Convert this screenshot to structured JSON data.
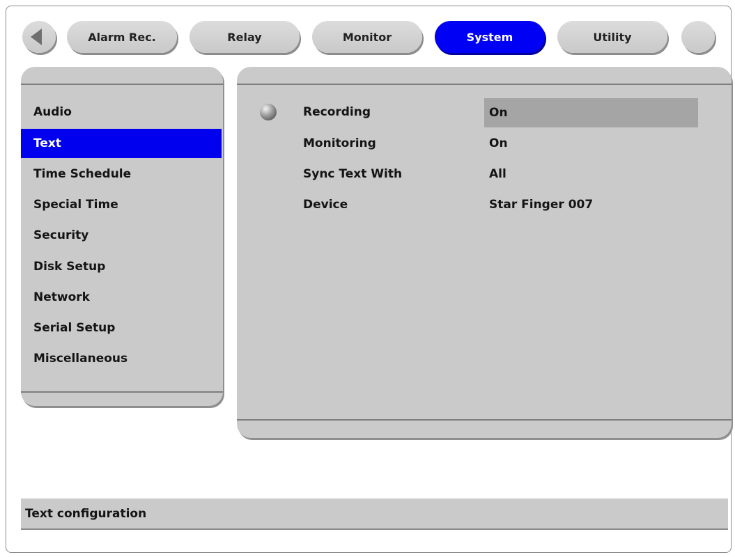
{
  "tabs": [
    {
      "label": "Alarm Rec."
    },
    {
      "label": "Relay"
    },
    {
      "label": "Monitor"
    },
    {
      "label": "System",
      "active": true
    },
    {
      "label": "Utility"
    }
  ],
  "sidebar": {
    "items": [
      {
        "label": "Audio"
      },
      {
        "label": "Text",
        "selected": true
      },
      {
        "label": "Time Schedule"
      },
      {
        "label": "Special Time"
      },
      {
        "label": "Security"
      },
      {
        "label": "Disk Setup"
      },
      {
        "label": "Network"
      },
      {
        "label": "Serial Setup"
      },
      {
        "label": "Miscellaneous"
      }
    ]
  },
  "settings": {
    "rows": [
      {
        "label": "Recording",
        "value": "On"
      },
      {
        "label": "Monitoring",
        "value": "On"
      },
      {
        "label": "Sync Text With",
        "value": "All"
      },
      {
        "label": "Device",
        "value": "Star Finger 007"
      }
    ]
  },
  "status": {
    "text": "Text configuration"
  },
  "colors": {
    "accent": "#0000ee",
    "panel": "#cacaca",
    "focus": "#a5a5a5"
  },
  "icons": {
    "back": "left-arrow-icon",
    "bullet": "sphere-bullet-icon"
  }
}
